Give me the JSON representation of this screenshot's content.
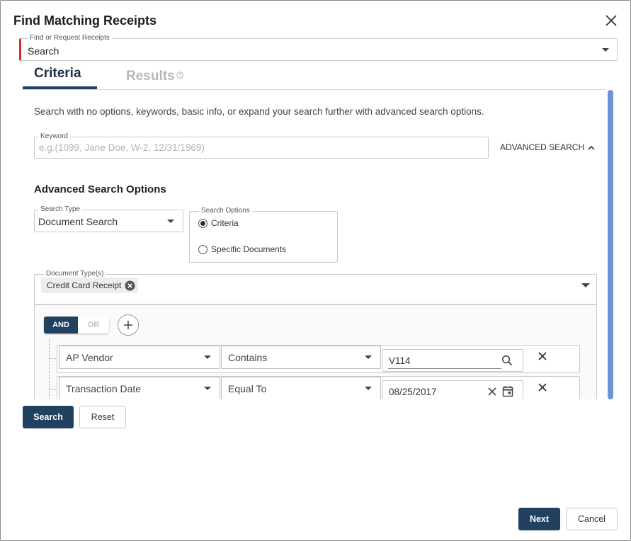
{
  "dialog": {
    "title": "Find Matching Receipts"
  },
  "find": {
    "label": "Find or Request Receipts",
    "value": "Search"
  },
  "tabs": {
    "criteria": "Criteria",
    "results": "Results"
  },
  "criteria": {
    "intro": "Search with no options, keywords, basic info, or expand your search further with advanced search options.",
    "keyword": {
      "label": "Keyword",
      "placeholder": "e.g.(1099, Jane Doe, W-2, 12/31/1969)"
    },
    "advanced_toggle": "ADVANCED SEARCH",
    "advanced_heading": "Advanced Search Options",
    "search_type": {
      "label": "Search Type",
      "value": "Document Search"
    },
    "search_options": {
      "label": "Search Options",
      "criteria": "Criteria",
      "specific": "Specific Documents",
      "selected": "Criteria"
    },
    "doc_types": {
      "label": "Document Type(s)",
      "chip": "Credit Card Receipt"
    },
    "logic": {
      "and": "AND",
      "or": "OR",
      "active": "AND"
    },
    "rules": [
      {
        "field": "AP Vendor",
        "operator": "Contains",
        "value": "V114"
      },
      {
        "field": "Transaction Date",
        "operator": "Equal To",
        "value": "08/25/2017"
      }
    ]
  },
  "actions": {
    "search": "Search",
    "reset": "Reset",
    "next": "Next",
    "cancel": "Cancel"
  },
  "colors": {
    "primary": "#22405f",
    "required": "#d32f2f",
    "scroll": "#6d93d6"
  }
}
